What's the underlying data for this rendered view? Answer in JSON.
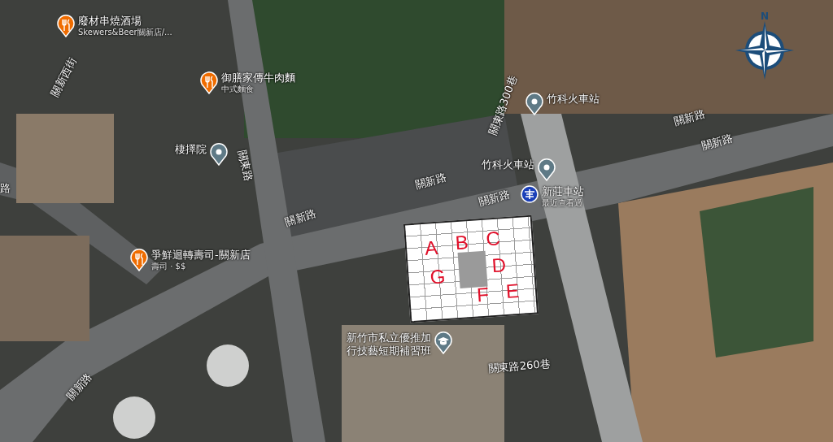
{
  "map": {
    "pois": [
      {
        "kind": "restaurant",
        "name": "廢材串燒酒場",
        "subtitle": "Skewers&Beer關新店/..."
      },
      {
        "kind": "restaurant",
        "name": "御膳家傳牛肉麵",
        "subtitle": "中式麵食"
      },
      {
        "kind": "place",
        "name": "棲擇院"
      },
      {
        "kind": "place",
        "name": "竹科火車站"
      },
      {
        "kind": "place",
        "name": "竹科火車站"
      },
      {
        "kind": "train",
        "name": "新莊車站",
        "subtitle": "最近查看過"
      },
      {
        "kind": "restaurant",
        "name": "爭鮮迴轉壽司-關新店",
        "subtitle": "壽司 · $$"
      },
      {
        "kind": "school",
        "name": "新竹市私立優推加",
        "subtitle": "行技藝短期補習班"
      }
    ],
    "road_labels": [
      "關新西街",
      "關東路",
      "關東路300巷",
      "關新路",
      "關新路",
      "關新路",
      "關新路",
      "關新路",
      "關新路",
      "關東路260巷",
      "路"
    ],
    "floor_plan": {
      "units": [
        "A",
        "B",
        "C",
        "D",
        "E",
        "F",
        "G"
      ]
    },
    "compass": {
      "label": "N"
    }
  }
}
